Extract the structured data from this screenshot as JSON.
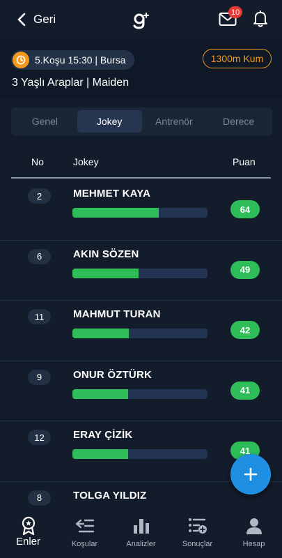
{
  "header": {
    "back_label": "Geri",
    "mail_badge": "10"
  },
  "race": {
    "info": "5.Koşu 15:30 | Bursa",
    "track": "1300m Kum",
    "title": "3 Yaşlı Araplar | Maiden"
  },
  "tabs": [
    {
      "label": "Genel",
      "active": false
    },
    {
      "label": "Jokey",
      "active": true
    },
    {
      "label": "Antrenör",
      "active": false
    },
    {
      "label": "Derece",
      "active": false
    }
  ],
  "table": {
    "headers": {
      "no": "No",
      "jockey": "Jokey",
      "score": "Puan"
    },
    "rows": [
      {
        "no": "2",
        "name": "MEHMET KAYA",
        "score": "64",
        "fill": 0.64
      },
      {
        "no": "6",
        "name": "AKIN SÖZEN",
        "score": "49",
        "fill": 0.49
      },
      {
        "no": "11",
        "name": "MAHMUT TURAN",
        "score": "42",
        "fill": 0.42
      },
      {
        "no": "9",
        "name": "ONUR ÖZTÜRK",
        "score": "41",
        "fill": 0.41
      },
      {
        "no": "12",
        "name": "ERAY ÇİZİK",
        "score": "41",
        "fill": 0.41
      },
      {
        "no": "8",
        "name": "TOLGA YILDIZ",
        "score": "",
        "fill": 0.0
      }
    ]
  },
  "bottom_nav": [
    {
      "label": "Enler",
      "icon": "medal-icon",
      "active": true
    },
    {
      "label": "Koşular",
      "icon": "list-arrow-icon",
      "active": false
    },
    {
      "label": "Analizler",
      "icon": "bar-chart-icon",
      "active": false
    },
    {
      "label": "Sonuçlar",
      "icon": "list-add-icon",
      "active": false
    },
    {
      "label": "Hesap",
      "icon": "user-icon",
      "active": false
    }
  ],
  "colors": {
    "background": "#131c2b",
    "accent_orange": "#f39a1e",
    "score_green": "#2ebd59",
    "fab_blue": "#1f8fe3",
    "badge_red": "#e53935"
  }
}
